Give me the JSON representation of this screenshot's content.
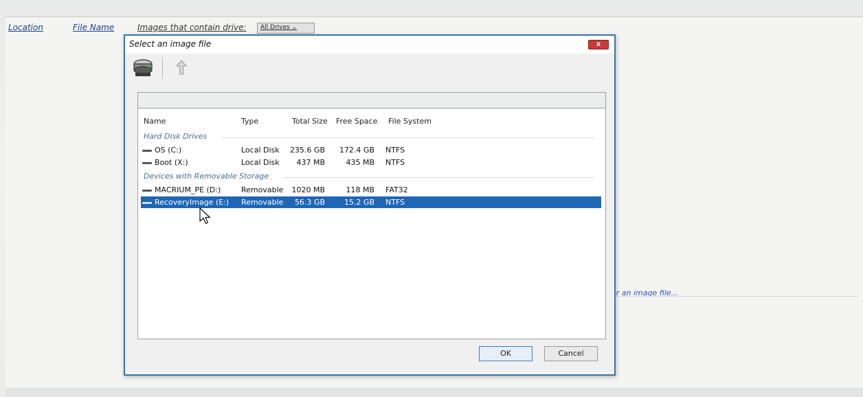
{
  "background": {
    "columns": {
      "location": "Location",
      "file_name": "File Name"
    },
    "contain_label": "Images that contain drive:",
    "drive_filter_value": "All Drives",
    "image_link": "or an image file..."
  },
  "dialog": {
    "title": "Select an image file",
    "close_label": "x",
    "toolbar": {
      "drive_icon": "drive-icon",
      "up_icon": "up-arrow-icon"
    },
    "columns": {
      "name": "Name",
      "type": "Type",
      "total": "Total Size",
      "free": "Free Space",
      "fs": "File System"
    },
    "groups": [
      {
        "label": "Hard Disk Drives",
        "rows": [
          {
            "name": "OS (C:)",
            "type": "Local Disk",
            "total": "235.6 GB",
            "free": "172.4 GB",
            "fs": "NTFS"
          },
          {
            "name": "Boot (X:)",
            "type": "Local Disk",
            "total": "437 MB",
            "free": "435 MB",
            "fs": "NTFS"
          }
        ]
      },
      {
        "label": "Devices with Removable Storage",
        "rows": [
          {
            "name": "MACRIUM_PE (D:)",
            "type": "Removable",
            "total": "1020 MB",
            "free": "118 MB",
            "fs": "FAT32"
          },
          {
            "name": "RecoveryImage (E:)",
            "type": "Removable",
            "total": "56.3 GB",
            "free": "15.2 GB",
            "fs": "NTFS"
          }
        ]
      }
    ],
    "ok_label": "OK",
    "cancel_label": "Cancel"
  },
  "colors": {
    "selection": "#1f66b5",
    "dialog_border": "#3b73a6",
    "close_button": "#c8393a",
    "link": "#2a55c0"
  }
}
